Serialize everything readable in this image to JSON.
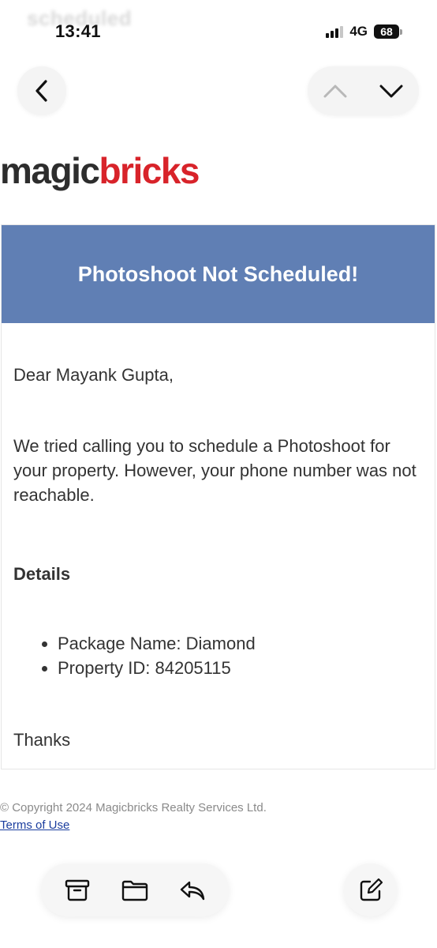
{
  "status_bar": {
    "ghost_title": "scheduled",
    "time": "13:41",
    "network": "4G",
    "battery": "68"
  },
  "nav": {
    "back_icon": "chevron-left-icon",
    "prev_icon": "chevron-up-icon",
    "next_icon": "chevron-down-icon"
  },
  "logo": {
    "part1": "magic",
    "part2": "bricks",
    "brand_color": "#d8232a"
  },
  "email": {
    "banner_title": "Photoshoot Not Scheduled!",
    "banner_color": "#607fb4",
    "greeting": "Dear Mayank Gupta,",
    "paragraph": "We tried calling you to schedule a Photoshoot for your property. However, your phone number was not reachable.",
    "details_heading": "Details",
    "details": [
      "Package Name: Diamond",
      "Property ID: 84205115"
    ],
    "sign_off": "Thanks"
  },
  "footer": {
    "copyright": "© Copyright 2024 Magicbricks Realty Services Ltd.",
    "terms": "Terms of Use"
  },
  "toolbar": {
    "archive_icon": "archive-icon",
    "move_icon": "folder-icon",
    "reply_icon": "reply-icon",
    "compose_icon": "compose-icon"
  }
}
